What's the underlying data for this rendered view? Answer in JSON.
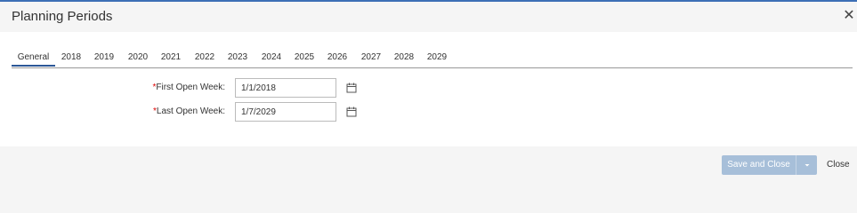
{
  "dialog": {
    "title": "Planning Periods",
    "close_icon": "close-icon"
  },
  "tabs": [
    {
      "label": "General",
      "active": true
    },
    {
      "label": "2018"
    },
    {
      "label": "2019"
    },
    {
      "label": "2020"
    },
    {
      "label": "2021"
    },
    {
      "label": "2022"
    },
    {
      "label": "2023"
    },
    {
      "label": "2024"
    },
    {
      "label": "2025"
    },
    {
      "label": "2026"
    },
    {
      "label": "2027"
    },
    {
      "label": "2028"
    },
    {
      "label": "2029"
    }
  ],
  "form": {
    "required_marker": "*",
    "first_open_week": {
      "label": "First Open Week:",
      "value": "1/1/2018",
      "icon": "calendar-icon"
    },
    "last_open_week": {
      "label": "Last Open Week:",
      "value": "1/7/2029",
      "icon": "calendar-icon"
    }
  },
  "footer": {
    "save_label": "Save and Close",
    "dropdown_icon": "chevron-down-icon",
    "close_label": "Close"
  },
  "colors": {
    "accent": "#3d6fb6",
    "button_disabled": "#a7bfd9",
    "required": "#dd0000"
  }
}
